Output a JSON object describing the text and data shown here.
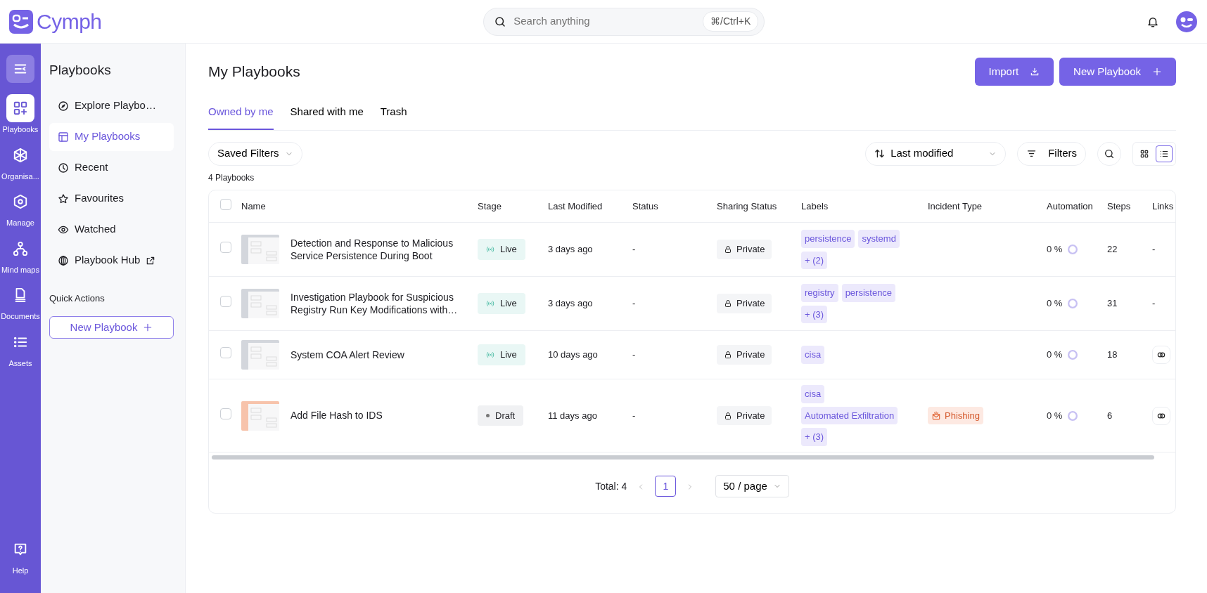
{
  "app": {
    "name": "Cymph"
  },
  "search": {
    "placeholder": "Search anything",
    "shortcut": "⌘/Ctrl+K"
  },
  "rail": {
    "items": [
      {
        "kind": "playbooks",
        "label": "Playbooks",
        "selected": true
      },
      {
        "kind": "organisation",
        "label": "Organisa...",
        "selected": false
      },
      {
        "kind": "manage",
        "label": "Manage",
        "selected": false
      },
      {
        "kind": "mindmaps",
        "label": "Mind maps",
        "selected": false
      },
      {
        "kind": "documents",
        "label": "Documents",
        "selected": false
      },
      {
        "kind": "assets",
        "label": "Assets",
        "selected": false
      }
    ],
    "help": "Help"
  },
  "sidebar": {
    "title": "Playbooks",
    "items": [
      {
        "kind": "explore",
        "label": "Explore Playbo…",
        "selected": false,
        "external": false
      },
      {
        "kind": "mine",
        "label": "My Playbooks",
        "selected": true,
        "external": false
      },
      {
        "kind": "recent",
        "label": "Recent",
        "selected": false,
        "external": false
      },
      {
        "kind": "favourites",
        "label": "Favourites",
        "selected": false,
        "external": false
      },
      {
        "kind": "watched",
        "label": "Watched",
        "selected": false,
        "external": false
      },
      {
        "kind": "hub",
        "label": "Playbook Hub",
        "selected": false,
        "external": true
      }
    ],
    "quick_actions": {
      "title": "Quick Actions",
      "button": "New Playbook"
    }
  },
  "main": {
    "title": "My Playbooks",
    "actions": [
      {
        "kind": "import",
        "label": "Import"
      },
      {
        "kind": "new",
        "label": "New Playbook"
      }
    ],
    "tabs": [
      {
        "label": "Owned by me",
        "selected": true
      },
      {
        "label": "Shared with me",
        "selected": false
      },
      {
        "label": "Trash",
        "selected": false
      }
    ],
    "saved_filters": "Saved Filters",
    "sort": "Last modified",
    "filters": "Filters",
    "views": [
      {
        "kind": "grid",
        "selected": false
      },
      {
        "kind": "list",
        "selected": true
      }
    ],
    "count": "4 Playbooks",
    "table": {
      "all_checked": false,
      "columns": [
        "Name",
        "Stage",
        "Last Modified",
        "Status",
        "Sharing Status",
        "Labels",
        "Incident Type",
        "Automation",
        "Steps",
        "Links"
      ],
      "rows": [
        {
          "checked": false,
          "color": "#d3d6dc",
          "name": "Detection and Response to Malicious Service Persistence During Boot",
          "stage": {
            "kind": "live",
            "label": "Live"
          },
          "modified": "3 days ago",
          "status": "-",
          "sharing": "Private",
          "labels": [
            "persistence",
            "systemd",
            "+ (2)"
          ],
          "automation": "0 %",
          "steps": "22",
          "links": {
            "kind": "text",
            "text": "-"
          }
        },
        {
          "checked": false,
          "color": "#d3d6dc",
          "name": "Investigation Playbook for Suspicious Registry Run Key Modifications with…",
          "stage": {
            "kind": "live",
            "label": "Live"
          },
          "modified": "3 days ago",
          "status": "-",
          "sharing": "Private",
          "labels": [
            "registry",
            "persistence",
            "+ (3)"
          ],
          "automation": "0 %",
          "steps": "31",
          "links": {
            "kind": "text",
            "text": "-"
          }
        },
        {
          "checked": false,
          "color": "#d3d6dc",
          "name": "System COA Alert Review",
          "stage": {
            "kind": "live",
            "label": "Live"
          },
          "modified": "10 days ago",
          "status": "-",
          "sharing": "Private",
          "labels": [
            "cisa"
          ],
          "automation": "0 %",
          "steps": "18",
          "links": {
            "kind": "icon"
          }
        },
        {
          "checked": false,
          "color": "#f7c3ab",
          "name": "Add File Hash to IDS",
          "stage": {
            "kind": "draft",
            "label": "Draft"
          },
          "modified": "11 days ago",
          "status": "-",
          "sharing": "Private",
          "labels": [
            "cisa",
            "Automated Exfiltration",
            "+ (3)"
          ],
          "incident": "Phishing",
          "automation": "0 %",
          "steps": "6",
          "links": {
            "kind": "icon"
          }
        }
      ]
    },
    "pagination": {
      "total": "Total: 4",
      "pages": [
        {
          "label": "1",
          "selected": true
        }
      ],
      "page_size": "50 / page"
    }
  }
}
